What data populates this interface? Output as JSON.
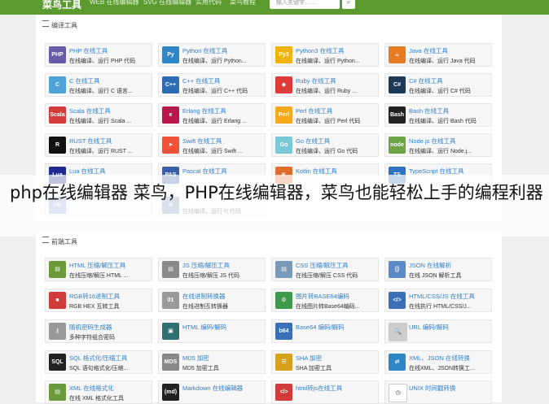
{
  "header": {
    "logo": "菜鸟工具",
    "nav": [
      "WEB 在线编辑器",
      "SVG 在线编辑器",
      "实用代码",
      "菜鸟教程"
    ],
    "search_placeholder": "输入关键字……",
    "search_icon": "search-icon"
  },
  "caption": "php在线编辑器 菜鸟，PHP在线编辑器，菜鸟也能轻松上手的编程利器",
  "sections": [
    {
      "title": "编译工具",
      "tiles": [
        {
          "icon": "php-icon",
          "glyph": "PHP",
          "color": "#6a5ba8",
          "title": "PHP 在线工具",
          "desc": "在线编译、运行 PHP 代码"
        },
        {
          "icon": "python-icon",
          "glyph": "Py",
          "color": "#2f86c6",
          "title": "Python 在线工具",
          "desc": "在线编译、运行 Python..."
        },
        {
          "icon": "python3-icon",
          "glyph": "Py3",
          "color": "#f0b400",
          "title": "Python3 在线工具",
          "desc": "在线编译、运行 Python..."
        },
        {
          "icon": "java-icon",
          "glyph": "☕",
          "color": "#e77c21",
          "title": "Java 在线工具",
          "desc": "在线编译、运行 Java 代码"
        },
        {
          "icon": "c-icon",
          "glyph": "C",
          "color": "#4fa3d9",
          "title": "C 在线工具",
          "desc": "在线编译、运行 C 语言..."
        },
        {
          "icon": "cpp-icon",
          "glyph": "C++",
          "color": "#2d6cb5",
          "title": "C++ 在线工具",
          "desc": "在线编译、运行 C++ 代码"
        },
        {
          "icon": "ruby-icon",
          "glyph": "◆",
          "color": "#e03b3b",
          "title": "Ruby 在线工具",
          "desc": "在线编译、运行 Ruby ..."
        },
        {
          "icon": "csharp-icon",
          "glyph": "C#",
          "color": "#1c3a57",
          "title": "C# 在线工具",
          "desc": "在线编译、运行 C# 代码"
        },
        {
          "icon": "scala-icon",
          "glyph": "Scala",
          "color": "#d33b3b",
          "title": "Scala 在线工具",
          "desc": "在线编译、运行 Scala ..."
        },
        {
          "icon": "erlang-icon",
          "glyph": "e",
          "color": "#b9174a",
          "title": "Erlang 在线工具",
          "desc": "在线编译、运行 Erlang ..."
        },
        {
          "icon": "perl-icon",
          "glyph": "Perl",
          "color": "#f4a81c",
          "title": "Perl 在线工具",
          "desc": "在线编译、运行 Perl 代码"
        },
        {
          "icon": "bash-icon",
          "glyph": "Bash",
          "color": "#222222",
          "title": "Bash 在线工具",
          "desc": "在线编译、运行 Bash 代码"
        },
        {
          "icon": "rust-icon",
          "glyph": "R",
          "color": "#111111",
          "title": "RUST 在线工具",
          "desc": "在线编译、运行 RUST ..."
        },
        {
          "icon": "swift-icon",
          "glyph": "➤",
          "color": "#f05138",
          "title": "Swift 在线工具",
          "desc": "在线编译、运行 Swift ..."
        },
        {
          "icon": "go-icon",
          "glyph": "Go",
          "color": "#79c8d6",
          "title": "Go 在线工具",
          "desc": "在线编译、运行 Go 代码"
        },
        {
          "icon": "nodejs-icon",
          "glyph": "node",
          "color": "#6da544",
          "title": "Node.js 在线工具",
          "desc": "在线编译、运行 Node.j..."
        },
        {
          "icon": "lua-icon",
          "glyph": "Lua",
          "color": "#1f2a8c",
          "title": "Lua 在线工具",
          "desc": ""
        },
        {
          "icon": "pascal-icon",
          "glyph": "PAS",
          "color": "#3a5fa8",
          "title": "Pascal 在线工具",
          "desc": ""
        },
        {
          "icon": "kotlin-icon",
          "glyph": "K",
          "color": "#e06b2a",
          "title": "Kotlin 在线工具",
          "desc": ""
        },
        {
          "icon": "typescript-icon",
          "glyph": "TS",
          "color": "#2f74c0",
          "title": "TypeScript 在线工具",
          "desc": ""
        },
        {
          "icon": "vb-icon",
          "glyph": "VB",
          "color": "#8aa0c8",
          "title": "",
          "desc": ""
        },
        {
          "icon": "r-icon",
          "glyph": "R",
          "color": "#7a8fb0",
          "title": "",
          "desc": "在线编译、运行 R 代码"
        }
      ]
    },
    {
      "title": "前端工具",
      "tiles": [
        {
          "icon": "html-compress-icon",
          "glyph": "▤",
          "color": "#6a9a3a",
          "title": "HTML 压缩/解压工具",
          "desc": "在线压缩/解压 HTML ..."
        },
        {
          "icon": "js-compress-icon",
          "glyph": "▤",
          "color": "#8a8a8a",
          "title": "JS 压缩/解压工具",
          "desc": "在线压缩/解压 JS 代码"
        },
        {
          "icon": "css-compress-icon",
          "glyph": "▤",
          "color": "#7a9aba",
          "title": "CSS 压缩/解压工具",
          "desc": "在线压缩/解压 CSS 代码"
        },
        {
          "icon": "json-icon",
          "glyph": "{}",
          "color": "#5a8ac8",
          "title": "JSON 在线解析",
          "desc": "在线 JSON 解析工具"
        },
        {
          "icon": "rgb-hex-icon",
          "glyph": "■",
          "color": "#d23b3b",
          "title": "RGB转16进制工具",
          "desc": "RGB HEX 互转工具"
        },
        {
          "icon": "binary-icon",
          "glyph": "01",
          "color": "#9a9a9a",
          "title": "在线进制转换器",
          "desc": "在线进制互转换器"
        },
        {
          "icon": "base64-image-icon",
          "glyph": "⚙",
          "color": "#3e9a4a",
          "title": "图片转BASE64编码",
          "desc": "在线图片转Base64编码..."
        },
        {
          "icon": "html-css-js-icon",
          "glyph": "</>",
          "color": "#3b6fb8",
          "title": "HTML/CSS/JS 在线工具",
          "desc": "在线执行 HTML/CSS/J..."
        },
        {
          "icon": "password-icon",
          "glyph": "⚷",
          "color": "#999999",
          "title": "随机密码生成器",
          "desc": "多种字符组合密码"
        },
        {
          "icon": "html-encode-icon",
          "glyph": "▣",
          "color": "#2f6f6f",
          "title": "HTML 编码/解码",
          "desc": ""
        },
        {
          "icon": "base64-icon",
          "glyph": "b64",
          "color": "#3b6fb8",
          "title": "Base64 编码/解码",
          "desc": ""
        },
        {
          "icon": "url-icon",
          "glyph": "🔍",
          "color": "#cccccc",
          "title": "URL 编码/解码",
          "desc": ""
        },
        {
          "icon": "sql-icon",
          "glyph": "SQL",
          "color": "#222222",
          "title": "SQL 格式化/压缩工具",
          "desc": "SQL 语句格式化/压缩..."
        },
        {
          "icon": "md5-icon",
          "glyph": "MDS",
          "color": "#888888",
          "title": "MD5 加密",
          "desc": "MD5 加密工具"
        },
        {
          "icon": "sha-icon",
          "glyph": "☰",
          "color": "#d6a21c",
          "title": "SHA 加密",
          "desc": "SHA 加密工具"
        },
        {
          "icon": "xml-json-icon",
          "glyph": "⇄",
          "color": "#2f86c6",
          "title": "XML、JSON 在线转换",
          "desc": "在线XML、JSON转换工..."
        },
        {
          "icon": "xml-format-icon",
          "glyph": "▤",
          "color": "#6a9a3a",
          "title": "XML 在线格式化",
          "desc": "在线 XML 格式化工具"
        },
        {
          "icon": "markdown-icon",
          "glyph": "(md)",
          "color": "#222222",
          "title": "Markdown 在线编辑器",
          "desc": ""
        },
        {
          "icon": "html-js-icon",
          "glyph": "</>",
          "color": "#d33b3b",
          "title": "html转js在线工具",
          "desc": ""
        },
        {
          "icon": "unix-time-icon",
          "glyph": "◷",
          "color": "#ffffff",
          "title": "UNIX 时间戳转换",
          "desc": ""
        }
      ]
    }
  ]
}
